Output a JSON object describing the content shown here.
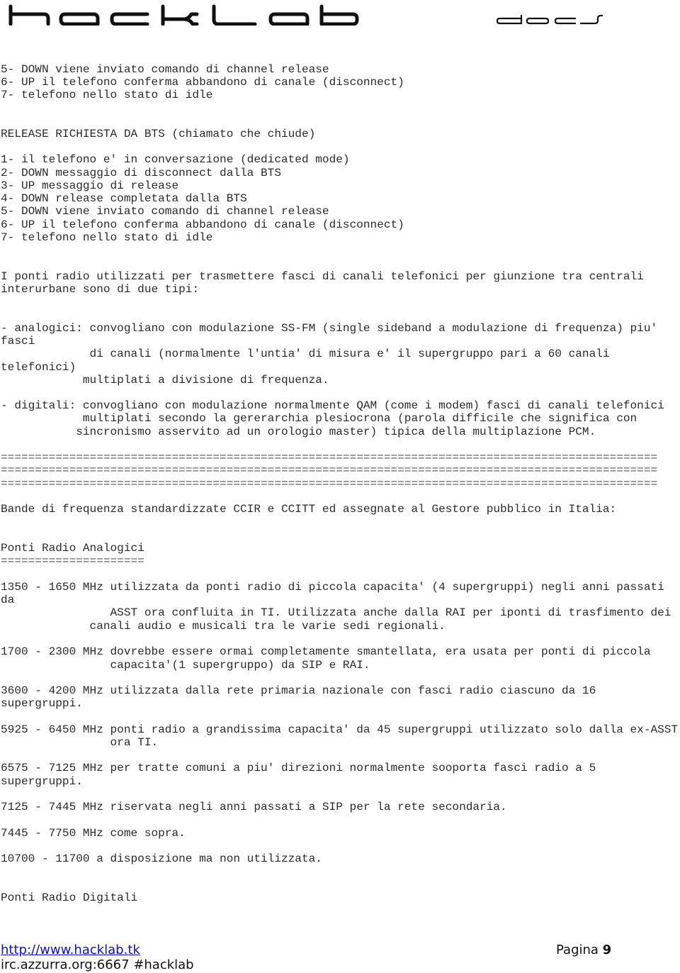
{
  "header": {
    "logo_text": "hacklab",
    "logo_sub": "docs"
  },
  "lines": [
    {
      "text": "5- DOWN viene inviato comando di channel release"
    },
    {
      "text": "6- UP il telefono conferma abbandono di canale (disconnect)"
    },
    {
      "text": "7- telefono nello stato di idle"
    },
    {
      "text": "RELEASE RICHIESTA DA BTS (chiamato che chiude)"
    },
    {
      "text": "1- il telefono e' in conversazione (dedicated mode)"
    },
    {
      "text": "2- DOWN messaggio di disconnect dalla BTS"
    },
    {
      "text": "3- UP messaggio di release"
    },
    {
      "text": "4- DOWN release completata dalla BTS"
    },
    {
      "text": "5- DOWN viene inviato comando di channel release"
    },
    {
      "text": "6- UP il telefono conferma abbandono di canale (disconnect)"
    },
    {
      "text": "7- telefono nello stato di idle"
    },
    {
      "text": "I ponti radio utilizzati per trasmettere fasci di canali telefonici per giunzione tra centrali"
    },
    {
      "text": "interurbane sono di due tipi:"
    },
    {
      "text": "- analogici: convogliano con modulazione SS-FM (single sideband a modulazione di frequenza) piu'"
    },
    {
      "text": "fasci"
    },
    {
      "text": "             di canali (normalmente l'untia' di misura e' il supergruppo pari a 60 canali"
    },
    {
      "text": "telefonici)"
    },
    {
      "text": "            multiplati a divisione di frequenza."
    },
    {
      "text": "- digitali: convogliano con modulazione normalmente QAM (come i modem) fasci di canali telefonici"
    },
    {
      "text": "            multiplati secondo la gererarchia plesiocrona (parola difficile che significa con"
    },
    {
      "text": "           sincronismo asservito ad un orologio master) tipica della multiplazione PCM."
    },
    {
      "text": "================================================================================================"
    },
    {
      "text": "================================================================================================"
    },
    {
      "text": "================================================================================================"
    },
    {
      "text": "Bande di frequenza standardizzate CCIR e CCITT ed assegnate al Gestore pubblico in Italia:"
    },
    {
      "text": "Ponti Radio Analogici"
    },
    {
      "text": "====================="
    },
    {
      "text": "1350 - 1650 MHz utilizzata da ponti radio di piccola capacita' (4 supergruppi) negli anni passati"
    },
    {
      "text": "da"
    },
    {
      "text": "                ASST ora confluita in TI. Utilizzata anche dalla RAI per iponti di trasfimento dei"
    },
    {
      "text": "             canali audio e musicali tra le varie sedi regionali."
    },
    {
      "text": "1700 - 2300 MHz dovrebbe essere ormai completamente smantellata, era usata per ponti di piccola"
    },
    {
      "text": "                capacita'(1 supergruppo) da SIP e RAI."
    },
    {
      "text": "3600 - 4200 MHz utilizzata dalla rete primaria nazionale con fasci radio ciascuno da 16"
    },
    {
      "text": "supergruppi."
    },
    {
      "text": "5925 - 6450 MHz ponti radio a grandissima capacita' da 45 supergruppi utilizzato solo dalla ex-ASST"
    },
    {
      "text": "                ora TI."
    },
    {
      "text": "6575 - 7125 MHz per tratte comuni a piu' direzioni normalmente sooporta fasci radio a 5"
    },
    {
      "text": "supergruppi."
    },
    {
      "text": "7125 - 7445 MHz riservata negli anni passati a SIP per la rete secondaria."
    },
    {
      "text": "7445 - 7750 MHz come sopra."
    },
    {
      "text": "10700 - 11700 a disposizione ma non utilizzata."
    },
    {
      "text": "Ponti Radio Digitali"
    }
  ],
  "footer": {
    "link": "http://www.hacklab.tk",
    "irc": "irc.azzurra.org:6667 #hacklab",
    "page_label": "Pagina ",
    "page_number": "9"
  }
}
